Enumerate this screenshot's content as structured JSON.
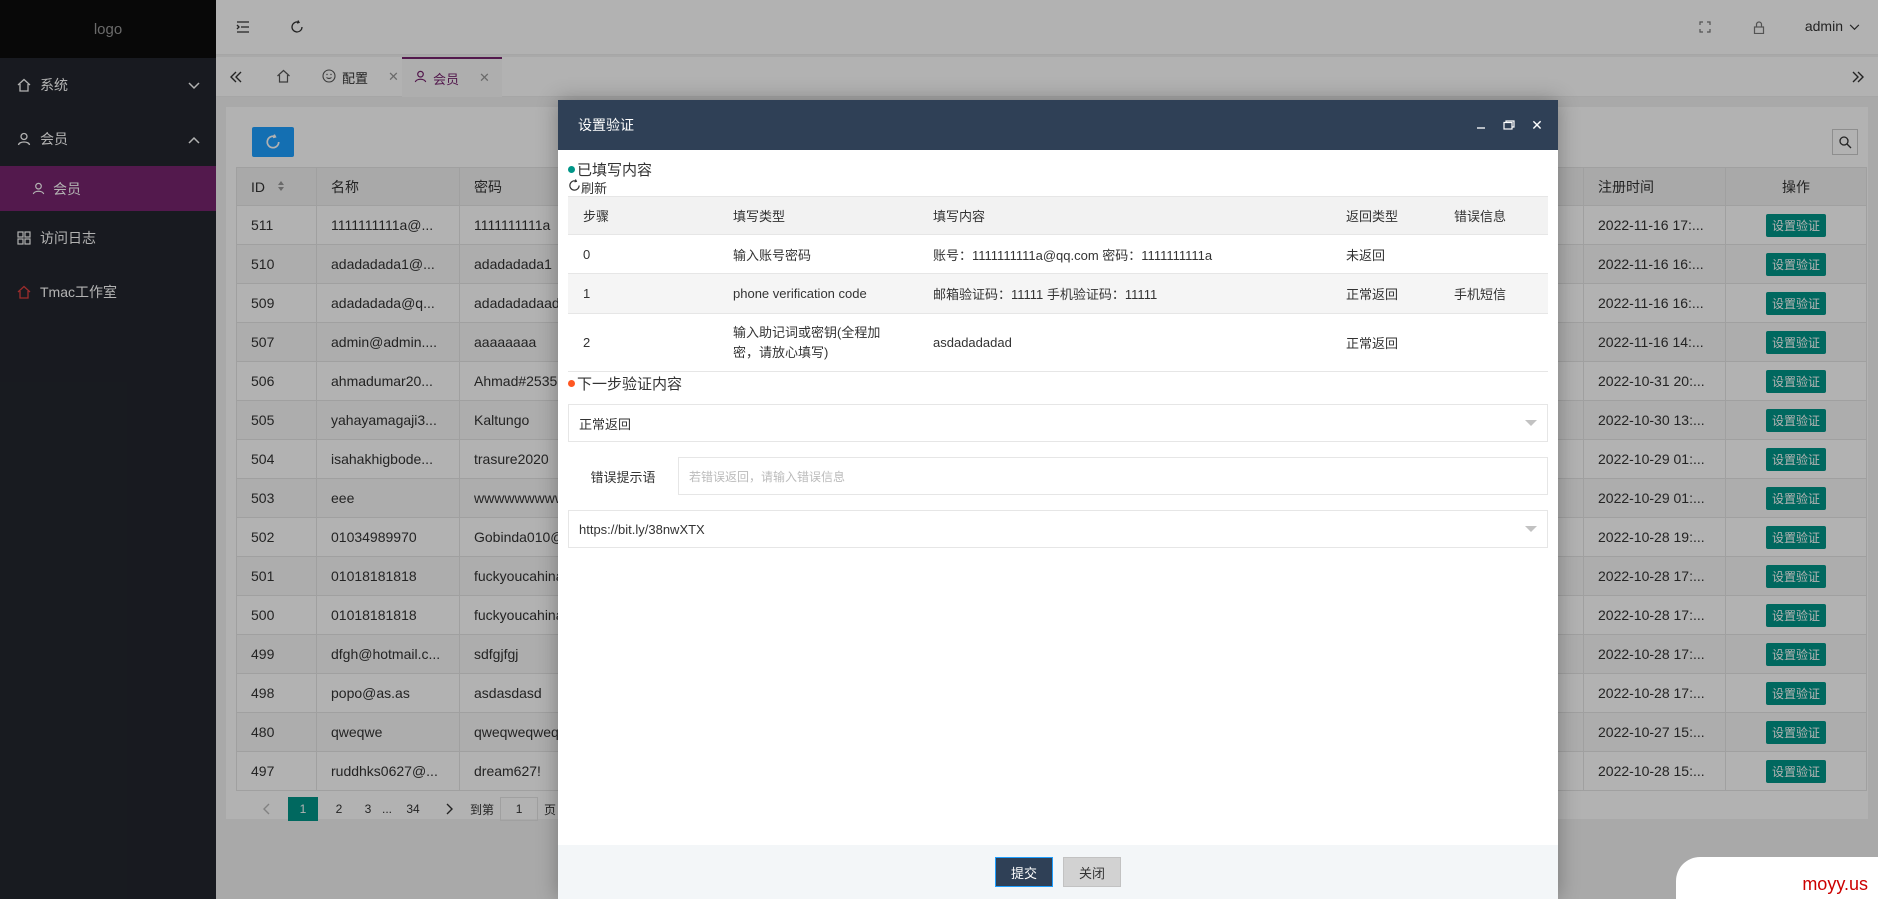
{
  "sidebar": {
    "logo_alt": "logo",
    "items": [
      {
        "label": "系统"
      },
      {
        "label": "会员"
      },
      {
        "label": "会员"
      },
      {
        "label": "访问日志"
      },
      {
        "label": "Tmac工作室"
      }
    ]
  },
  "header": {
    "user": "admin"
  },
  "tabs": [
    {
      "label": "配置"
    },
    {
      "label": "会员"
    }
  ],
  "grid": {
    "columns": [
      "ID",
      "名称",
      "密码",
      "注册时间",
      "操作"
    ],
    "action_label": "设置验证",
    "rows": [
      {
        "id": "511",
        "name": "1111111111a@...",
        "pwd": "1111111111a",
        "time": "2022-11-16 17:..."
      },
      {
        "id": "510",
        "name": "adadadada1@...",
        "pwd": "adadadada1",
        "time": "2022-11-16 16:..."
      },
      {
        "id": "509",
        "name": "adadadada@q...",
        "pwd": "adadadadaada",
        "time": "2022-11-16 16:..."
      },
      {
        "id": "507",
        "name": "admin@admin....",
        "pwd": "aaaaaaaa",
        "time": "2022-11-16 14:..."
      },
      {
        "id": "506",
        "name": "ahmadumar20...",
        "pwd": "Ahmad#2535",
        "time": "2022-10-31 20:..."
      },
      {
        "id": "505",
        "name": "yahayamagaji3...",
        "pwd": "Kaltungo",
        "time": "2022-10-30 13:..."
      },
      {
        "id": "504",
        "name": "isahakhigbode...",
        "pwd": "trasure2020",
        "time": "2022-10-29 01:..."
      },
      {
        "id": "503",
        "name": "eee",
        "pwd": "wwwwwwwww",
        "time": "2022-10-29 01:..."
      },
      {
        "id": "502",
        "name": "01034989970",
        "pwd": "Gobinda010@",
        "time": "2022-10-28 19:..."
      },
      {
        "id": "501",
        "name": "01018181818",
        "pwd": "fuckyoucahina",
        "time": "2022-10-28 17:..."
      },
      {
        "id": "500",
        "name": "01018181818",
        "pwd": "fuckyoucahina",
        "time": "2022-10-28 17:..."
      },
      {
        "id": "499",
        "name": "dfgh@hotmail.c...",
        "pwd": "sdfgjfgj",
        "time": "2022-10-28 17:..."
      },
      {
        "id": "498",
        "name": "popo@as.as",
        "pwd": "asdasdasd",
        "time": "2022-10-28 17:..."
      },
      {
        "id": "480",
        "name": "qweqwe",
        "pwd": "qweqweqweq",
        "time": "2022-10-27 15:..."
      },
      {
        "id": "497",
        "name": "ruddhks0627@...",
        "pwd": "dream627!",
        "time": "2022-10-28 15:..."
      }
    ]
  },
  "pager": {
    "pages": [
      "1",
      "2",
      "3",
      "...",
      "34"
    ],
    "goto_label": "到第",
    "goto_value": "1",
    "page_unit": "页"
  },
  "modal": {
    "title": "设置验证",
    "filled_title": "已填写内容",
    "refresh_label": "刷新",
    "columns": [
      "步骤",
      "填写类型",
      "填写内容",
      "返回类型",
      "错误信息"
    ],
    "rows": [
      {
        "step": "0",
        "type": "输入账号密码",
        "content": "账号：1111111111a@qq.com 密码：1111111111a",
        "ret": "未返回",
        "err": ""
      },
      {
        "step": "1",
        "type": "phone verification code",
        "content": "邮箱验证码：11111 手机验证码：11111",
        "ret": "正常返回",
        "err": "手机短信"
      },
      {
        "step": "2",
        "type": "输入助记词或密钥(全程加密，请放心填写)",
        "content": "asdadadadad",
        "ret": "正常返回",
        "err": ""
      }
    ],
    "next_title": "下一步验证内容",
    "return_select": "正常返回",
    "error_label": "错误提示语",
    "error_placeholder": "若错误返回，请输入错误信息",
    "url_select": "https://bit.ly/38nwXTX",
    "submit_label": "提交",
    "close_label": "关闭"
  },
  "watermark": "moyy.us",
  "colors": {
    "sidebar_bg": "#23262e",
    "sidebar_active": "#78256f",
    "modal_header": "#2f4056",
    "action_green": "#009688",
    "primary_blue": "#1e9fff",
    "dot_teal": "#009688",
    "dot_orange": "#ff5722"
  }
}
